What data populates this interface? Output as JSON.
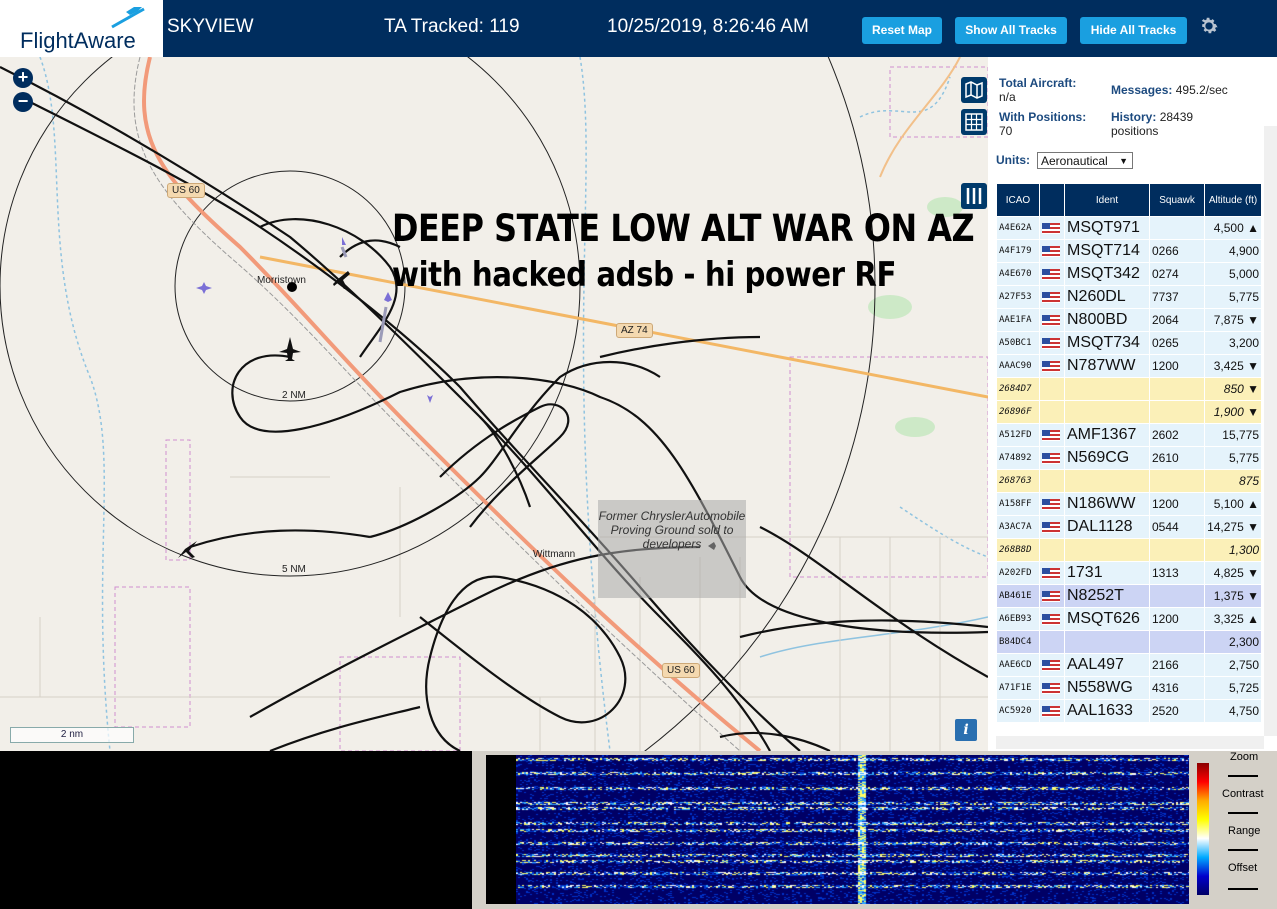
{
  "topbar": {
    "logo_text": "FlightAware",
    "site_name": "SKYVIEW",
    "tracked": "TA Tracked: 119",
    "datetime": "10/25/2019, 8:26:46 AM",
    "reset_map": "Reset Map",
    "show_tracks": "Show All Tracks",
    "hide_tracks": "Hide All Tracks"
  },
  "map": {
    "overlay_line1": "DEEP STATE LOW ALT WAR ON AZ",
    "overlay_line2": "with hacked adsb - hi power RF",
    "labels": {
      "us60_top": "US 60",
      "us60_bottom": "US 60",
      "az74": "AZ 74",
      "morristown": "Morristown",
      "wittmann": "Wittmann",
      "ring2": "2 NM",
      "ring5": "5 NM",
      "former": "Former ChryslerAutomobile Proving Ground sold to developers"
    },
    "scale": "2 nm",
    "zoom_in": "+",
    "zoom_out": "−",
    "info": "i"
  },
  "panel": {
    "total_aircraft_label": "Total Aircraft:",
    "total_aircraft_value": "n/a",
    "messages_label": "Messages:",
    "messages_value": "495.2/sec",
    "positions_label": "With Positions:",
    "positions_value": "70",
    "history_label": "History:",
    "history_value": "28439 positions",
    "units_label": "Units:",
    "units_value": "Aeronautical",
    "columns": [
      "ICAO",
      "Ident",
      "Squawk",
      "Altitude (ft)"
    ],
    "rows": [
      {
        "icao": "A4E62A",
        "ident": "MSQT971",
        "squawk": "",
        "alt": "4,500 ▲",
        "style": "blue",
        "flag": true
      },
      {
        "icao": "A4F179",
        "ident": "MSQT714",
        "squawk": "0266",
        "alt": "4,900",
        "style": "blue",
        "flag": true
      },
      {
        "icao": "A4E670",
        "ident": "MSQT342",
        "squawk": "0274",
        "alt": "5,000",
        "style": "blue",
        "flag": true
      },
      {
        "icao": "A27F53",
        "ident": "N260DL",
        "squawk": "7737",
        "alt": "5,775",
        "style": "blue",
        "flag": true
      },
      {
        "icao": "AAE1FA",
        "ident": "N800BD",
        "squawk": "2064",
        "alt": "7,875 ▼",
        "style": "blue",
        "flag": true
      },
      {
        "icao": "A50BC1",
        "ident": "MSQT734",
        "squawk": "0265",
        "alt": "3,200",
        "style": "blue",
        "flag": true
      },
      {
        "icao": "AAAC90",
        "ident": "N787WW",
        "squawk": "1200",
        "alt": "3,425 ▼",
        "style": "blue",
        "flag": true
      },
      {
        "icao": "2684D7",
        "ident": "",
        "squawk": "",
        "alt": "850 ▼",
        "style": "yellow",
        "flag": false
      },
      {
        "icao": "26896F",
        "ident": "",
        "squawk": "",
        "alt": "1,900 ▼",
        "style": "yellow",
        "flag": false
      },
      {
        "icao": "A512FD",
        "ident": "AMF1367",
        "squawk": "2602",
        "alt": "15,775",
        "style": "blue",
        "flag": true
      },
      {
        "icao": "A74892",
        "ident": "N569CG",
        "squawk": "2610",
        "alt": "5,775",
        "style": "blue",
        "flag": true
      },
      {
        "icao": "268763",
        "ident": "",
        "squawk": "",
        "alt": "875",
        "style": "yellow",
        "flag": false
      },
      {
        "icao": "A158FF",
        "ident": "N186WW",
        "squawk": "1200",
        "alt": "5,100 ▲",
        "style": "blue",
        "flag": true
      },
      {
        "icao": "A3AC7A",
        "ident": "DAL1128",
        "squawk": "0544",
        "alt": "14,275 ▼",
        "style": "blue",
        "flag": true
      },
      {
        "icao": "268B8D",
        "ident": "",
        "squawk": "",
        "alt": "1,300",
        "style": "yellow",
        "flag": false
      },
      {
        "icao": "A202FD",
        "ident": "1731",
        "squawk": "1313",
        "alt": "4,825 ▼",
        "style": "blue",
        "flag": true
      },
      {
        "icao": "AB461E",
        "ident": "N8252T",
        "squawk": "",
        "alt": "1,375 ▼",
        "style": "sel",
        "flag": true
      },
      {
        "icao": "A6EB93",
        "ident": "MSQT626",
        "squawk": "1200",
        "alt": "3,325 ▲",
        "style": "blue",
        "flag": true
      },
      {
        "icao": "B84DC4",
        "ident": "",
        "squawk": "",
        "alt": "2,300",
        "style": "sel",
        "flag": false
      },
      {
        "icao": "AAE6CD",
        "ident": "AAL497",
        "squawk": "2166",
        "alt": "2,750",
        "style": "blue",
        "flag": true
      },
      {
        "icao": "A71F1E",
        "ident": "N558WG",
        "squawk": "4316",
        "alt": "5,725",
        "style": "blue",
        "flag": true
      },
      {
        "icao": "AC5920",
        "ident": "AAL1633",
        "squawk": "2520",
        "alt": "4,750",
        "style": "blue",
        "flag": true
      }
    ]
  },
  "waterfall": {
    "zoom": "Zoom",
    "contrast": "Contrast",
    "range": "Range",
    "offset": "Offset"
  },
  "colors": {
    "topbar": "#002d5e",
    "button": "#1a9fe0",
    "row_blue": "#e5f3fb",
    "row_yellow": "#fbf0b8",
    "row_selected": "#ccd4f4",
    "highway": "#f29a7a",
    "az74": "#f3b765"
  }
}
